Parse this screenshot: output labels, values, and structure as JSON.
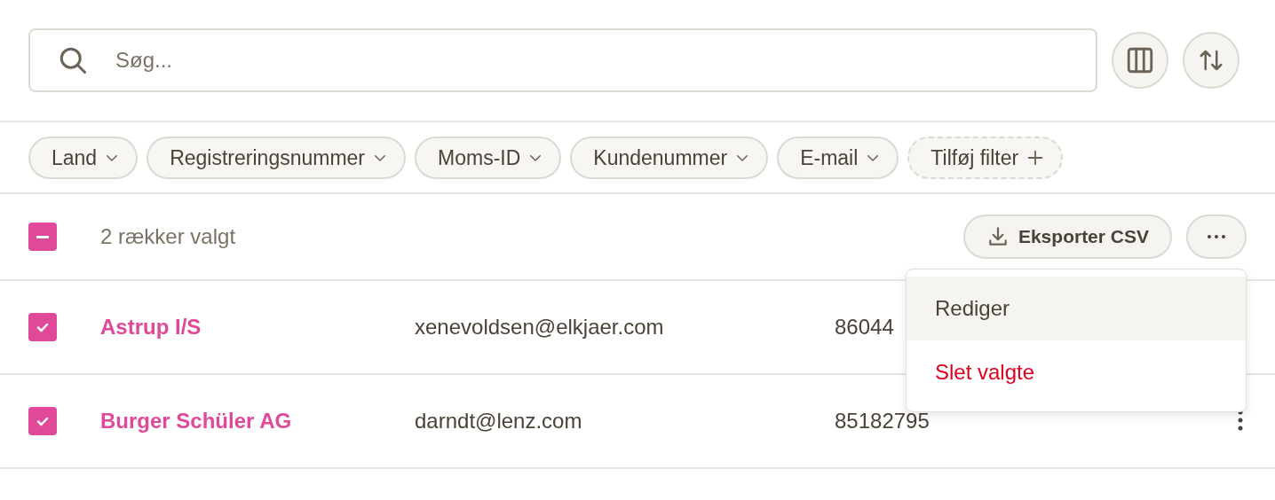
{
  "search": {
    "placeholder": "Søg..."
  },
  "view_buttons": [
    {
      "kind": "columns"
    },
    {
      "kind": "sort"
    }
  ],
  "filters": [
    {
      "label": "Land",
      "kind": "dropdown"
    },
    {
      "label": "Registreringsnummer",
      "kind": "dropdown"
    },
    {
      "label": "Moms-ID",
      "kind": "dropdown"
    },
    {
      "label": "Kundenummer",
      "kind": "dropdown"
    },
    {
      "label": "E-mail",
      "kind": "dropdown"
    },
    {
      "label": "Tilføj filter",
      "kind": "add"
    }
  ],
  "selection": {
    "indeterminate": true,
    "label": "2 rækker valgt",
    "export_button": "Eksporter CSV"
  },
  "menu": [
    {
      "label": "Rediger",
      "kind": "default",
      "highlighted": true
    },
    {
      "label": "Slet valgte",
      "kind": "danger",
      "highlighted": false
    }
  ],
  "rows": [
    {
      "selected": true,
      "name": "Astrup I/S",
      "email": "xenevoldsen@elkjaer.com",
      "number": "86044",
      "actions": false
    },
    {
      "selected": true,
      "name": "Burger Schüler AG",
      "email": "darndt@lenz.com",
      "number": "85182795",
      "actions": true
    }
  ]
}
